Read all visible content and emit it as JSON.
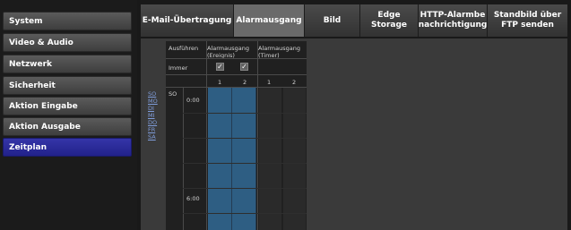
{
  "sidebar": {
    "items": [
      {
        "label": "System"
      },
      {
        "label": "Video & Audio"
      },
      {
        "label": "Netzwerk"
      },
      {
        "label": "Sicherheit"
      },
      {
        "label": "Aktion Eingabe"
      },
      {
        "label": "Aktion Ausgabe"
      },
      {
        "label": "Zeitplan"
      }
    ]
  },
  "tabs": [
    {
      "label": "E-Mail-Übertragung"
    },
    {
      "label": "Alarmausgang"
    },
    {
      "label": "Bild"
    },
    {
      "label": "Edge Storage"
    },
    {
      "label": "HTTP-Alarmbe nachrichtigung"
    },
    {
      "label": "Standbild über FTP senden"
    }
  ],
  "schedule": {
    "header_execute": "Ausführen",
    "header_alarm_event": "Alarmausgang (Ereignis)",
    "header_alarm_timer": "Alarmausgang (Timer)",
    "always_label": "Immer",
    "check_mark": "✓",
    "col_numbers": [
      "1",
      "2",
      "1",
      "2"
    ],
    "day_label": "SO",
    "times": [
      "0:00",
      "6:00"
    ],
    "days": [
      "SO",
      "MO",
      "DI",
      "MI",
      "DO",
      "FR",
      "SA"
    ]
  }
}
